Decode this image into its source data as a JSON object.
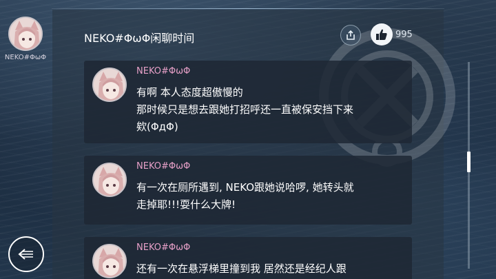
{
  "sidebar": {
    "user_name": "NEKO#ΦωΦ",
    "avatar_icon": "catgirl-avatar-icon"
  },
  "header": {
    "title": "NEKO#ΦωΦ闲聊时间",
    "share_icon": "share-icon",
    "like_icon": "thumbs-up-icon",
    "like_count": "995"
  },
  "messages": [
    {
      "author": "NEKO#ΦωΦ",
      "lines": [
        "有啊 本人态度超傲慢的",
        "那时候只是想去跟她打招呼还一直被保安挡下来",
        "欸(ΦдΦ)"
      ]
    },
    {
      "author": "NEKO#ΦωΦ",
      "lines": [
        "有一次在厕所遇到, NEKO跟她说哈啰, 她转头就",
        "走掉耶!!!耍什么大牌!"
      ]
    },
    {
      "author": "NEKO#ΦωΦ",
      "lines": [
        "还有一次在悬浮梯里撞到我 居然还是经纪人跟"
      ]
    }
  ],
  "back_icon": "back-arrow-icon",
  "colors": {
    "author_name": "#e7a0c8",
    "card_bg": "#1e2834",
    "accent": "#ffffff"
  }
}
